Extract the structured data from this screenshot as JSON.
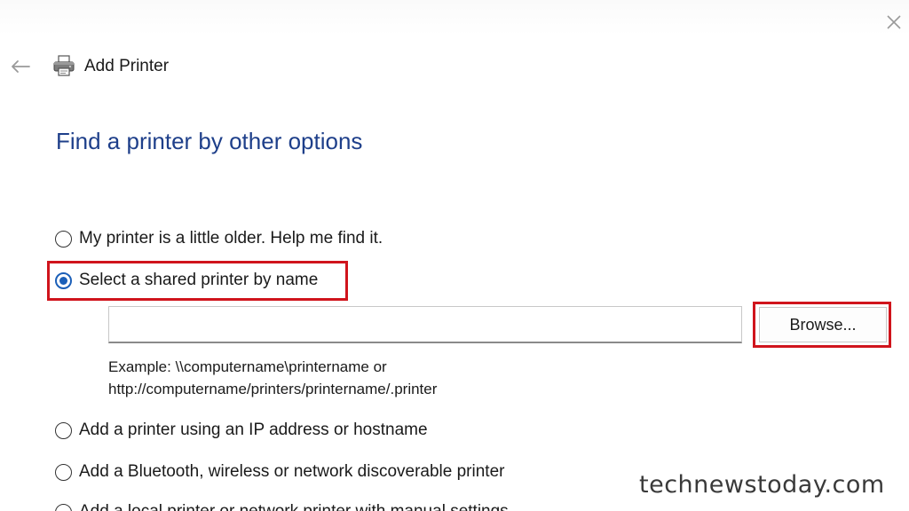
{
  "window": {
    "title": "Add Printer",
    "close_icon": "close-icon",
    "back_icon": "back-arrow-icon",
    "printer_icon": "printer-icon"
  },
  "main": {
    "heading": "Find a printer by other options",
    "options": [
      {
        "label": "My printer is a little older. Help me find it.",
        "checked": false
      },
      {
        "label": "Select a shared printer by name",
        "checked": true
      },
      {
        "label": "Add a printer using an IP address or hostname",
        "checked": false
      },
      {
        "label": "Add a Bluetooth, wireless or network discoverable printer",
        "checked": false
      },
      {
        "label": "Add a local printer or network printer with manual settings",
        "checked": false
      }
    ],
    "shared_printer": {
      "value": "",
      "placeholder": "",
      "browse_label": "Browse...",
      "example_line1": "Example: \\\\computername\\printername or",
      "example_line2": "http://computername/printers/printername/.printer"
    }
  },
  "watermark": "technewstoday.com",
  "colors": {
    "heading": "#1e3f8a",
    "highlight": "#d0141c",
    "radio_selected": "#1b5fb8"
  }
}
